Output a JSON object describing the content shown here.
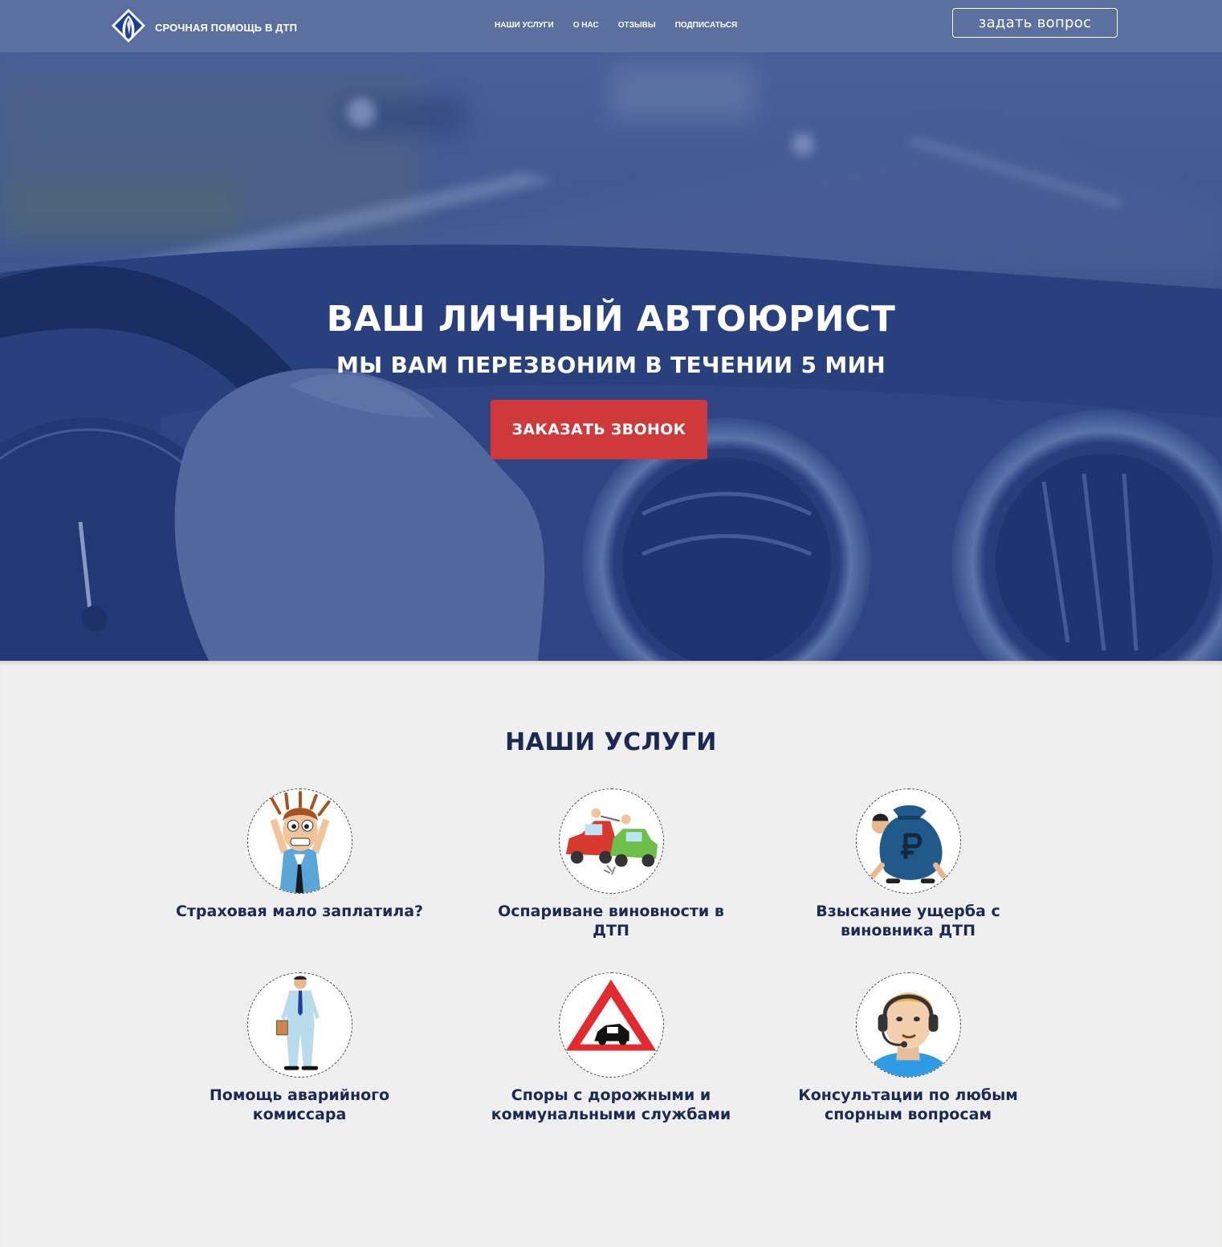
{
  "header": {
    "brand": "СРОЧНАЯ ПОМОЩЬ В ДТП",
    "nav": [
      "НАШИ УСЛУГИ",
      "О НАС",
      "ОТЗЫВЫ",
      "ПОДПИСАТЬСЯ"
    ],
    "ask_button": "задать вопрос"
  },
  "hero": {
    "title": "ВАШ ЛИЧНЫЙ АВТОЮРИСТ",
    "subtitle": "МЫ ВАМ ПЕРЕЗВОНИМ В ТЕЧЕНИИ 5 МИН",
    "cta": "ЗАКАЗАТЬ ЗВОНОК"
  },
  "services": {
    "title": "НАШИ УСЛУГИ",
    "items": [
      {
        "label": "Страховая мало заплатила?",
        "icon": "stressed-man-icon"
      },
      {
        "label": "Оспариване виновности в ДТП",
        "icon": "car-crash-icon"
      },
      {
        "label": "Взыскание ущерба с виновника ДТП",
        "icon": "ruble-money-bag-icon"
      },
      {
        "label": "Помощь аварийного комиссара",
        "icon": "commissioner-icon"
      },
      {
        "label": "Споры с дорожными и коммунальными службами",
        "icon": "road-warning-sign-icon"
      },
      {
        "label": "Консультации по любым спорным вопросам",
        "icon": "support-operator-icon"
      }
    ]
  },
  "colors": {
    "accent": "#d0393b",
    "navy": "#1b2a55",
    "nav_bg": "#5f73a0",
    "section_bg": "#efefef"
  }
}
